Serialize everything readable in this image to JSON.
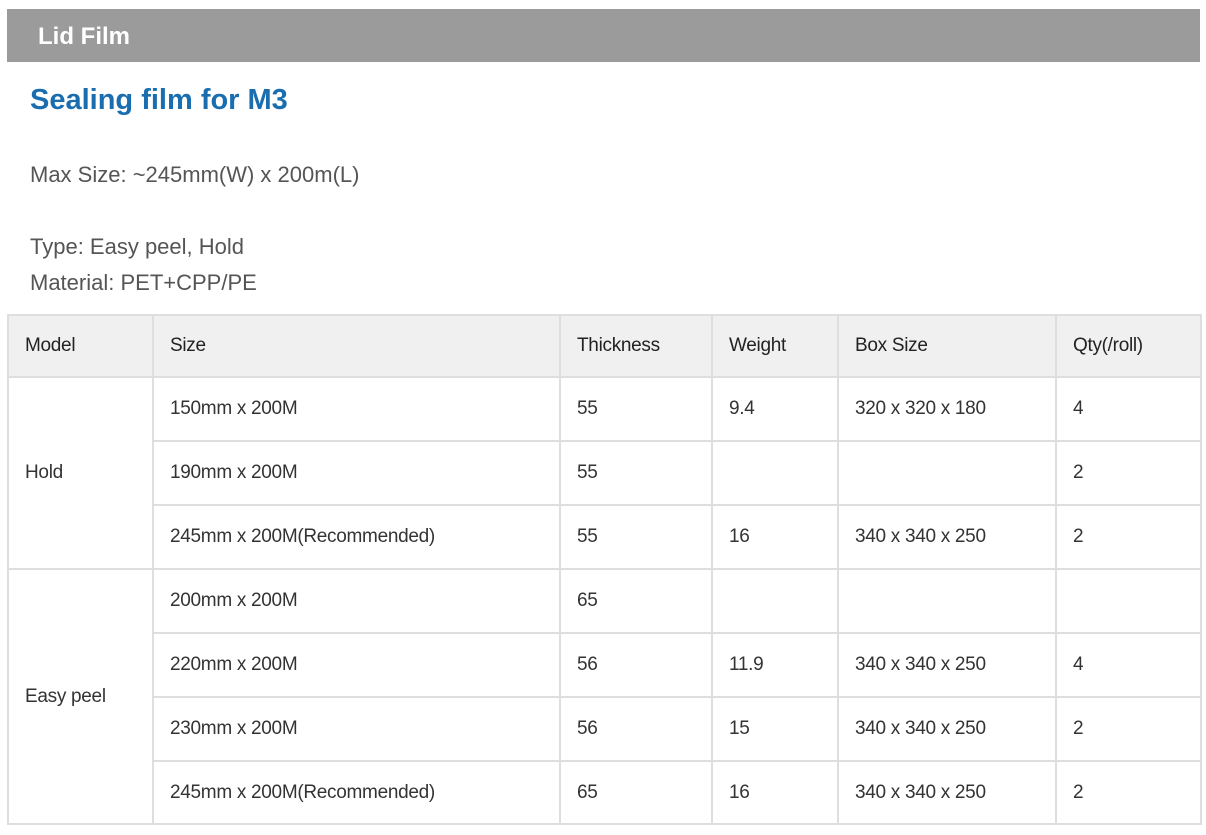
{
  "section": {
    "title": "Lid Film"
  },
  "product": {
    "title": "Sealing film for M3",
    "max_size": "Max Size: ~245mm(W) x 200m(L)",
    "type": "Type: Easy peel, Hold",
    "material": "Material: PET+CPP/PE"
  },
  "table": {
    "headers": [
      "Model",
      "Size",
      "Thickness",
      "Weight",
      "Box Size",
      "Qty(/roll)"
    ],
    "groups": [
      {
        "model": "Hold",
        "rows": [
          {
            "size": "150mm x 200M",
            "thickness": "55",
            "weight": "9.4",
            "box_size": "320 x 320 x 180",
            "qty": "4"
          },
          {
            "size": "190mm x 200M",
            "thickness": "55",
            "weight": "",
            "box_size": "",
            "qty": "2"
          },
          {
            "size": "245mm x 200M(Recommended)",
            "thickness": "55",
            "weight": "16",
            "box_size": "340 x 340 x 250",
            "qty": "2"
          }
        ]
      },
      {
        "model": "Easy peel",
        "rows": [
          {
            "size": "200mm x 200M",
            "thickness": "65",
            "weight": "",
            "box_size": "",
            "qty": ""
          },
          {
            "size": "220mm x 200M",
            "thickness": "56",
            "weight": "11.9",
            "box_size": "340 x 340 x 250",
            "qty": "4"
          },
          {
            "size": "230mm x 200M",
            "thickness": "56",
            "weight": "15",
            "box_size": "340 x 340 x 250",
            "qty": "2"
          },
          {
            "size": "245mm x 200M(Recommended)",
            "thickness": "65",
            "weight": "16",
            "box_size": "340 x 340 x 250",
            "qty": "2"
          }
        ]
      }
    ]
  }
}
